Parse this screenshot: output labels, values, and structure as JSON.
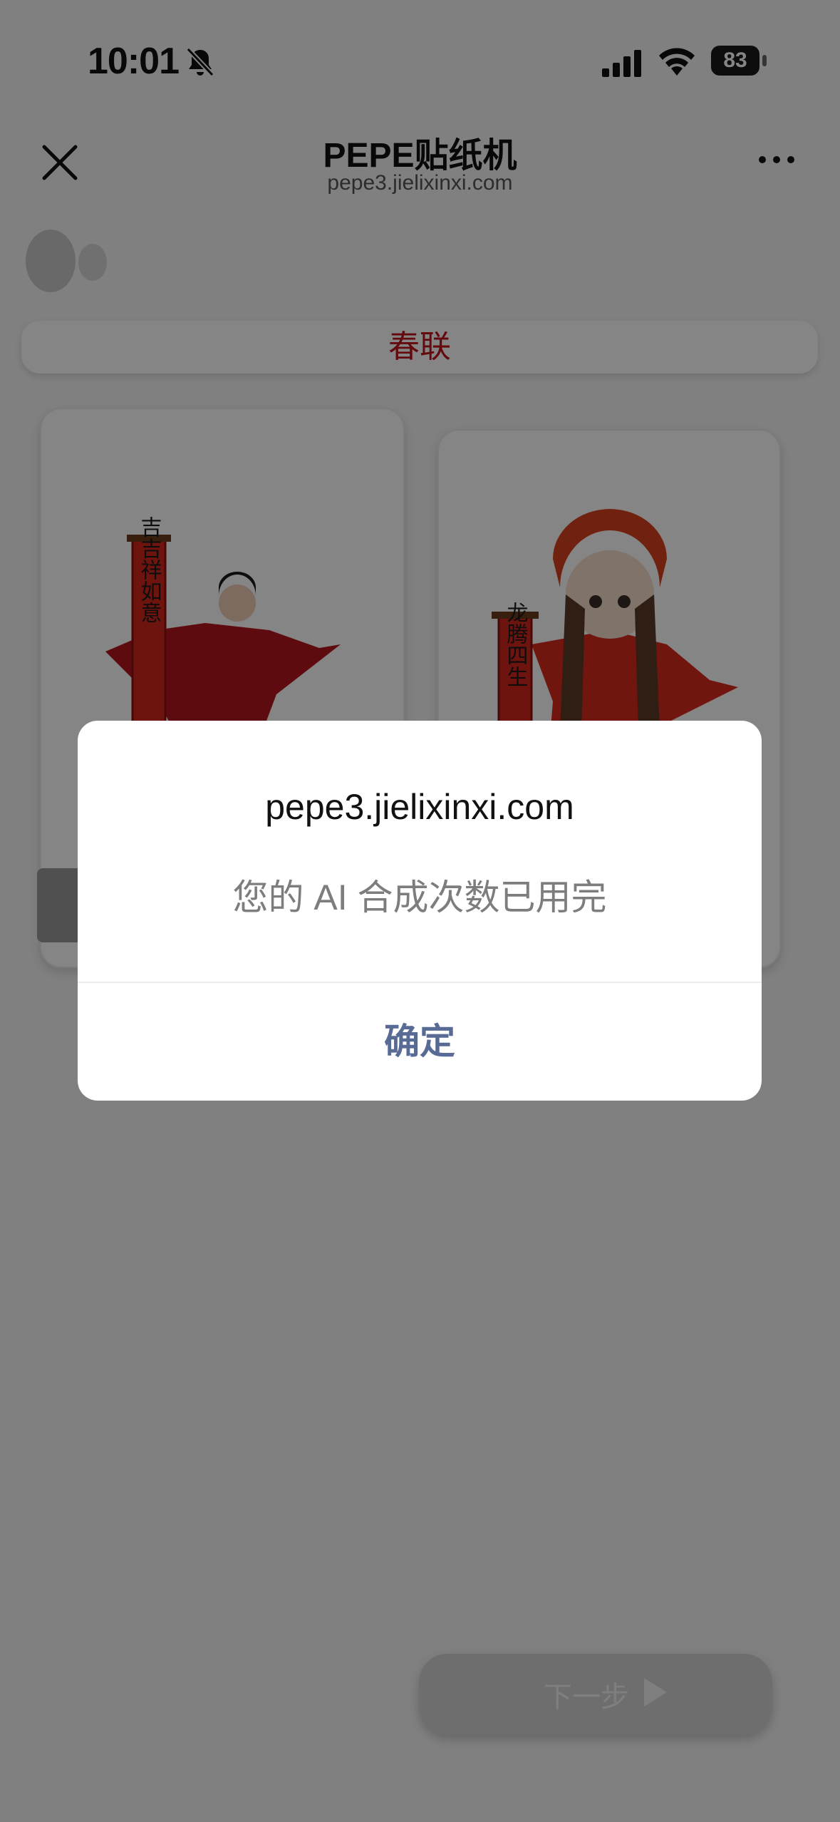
{
  "status_bar": {
    "time": "10:01",
    "battery": "83"
  },
  "header": {
    "title": "PEPE贴纸机",
    "subtitle": "pepe3.jielixinxi.com"
  },
  "tag": {
    "label": "春联"
  },
  "cards": [
    {
      "scroll_text": "吉吉祥如意"
    },
    {
      "scroll_text": "龙腾四生"
    }
  ],
  "next_button": {
    "label": "下一步"
  },
  "dialog": {
    "title": "pepe3.jielixinxi.com",
    "message": "您的 AI 合成次数已用完",
    "ok_label": "确定"
  },
  "colors": {
    "accent_red": "#c0141c",
    "dialog_button": "#576b95",
    "overlay": "rgba(0,0,0,0.48)"
  }
}
